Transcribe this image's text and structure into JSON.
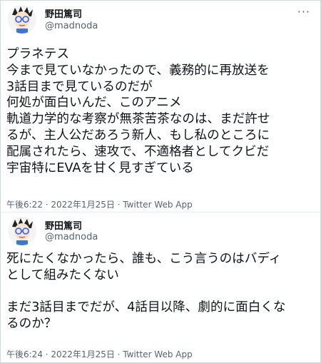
{
  "tweets": [
    {
      "author_name": "野田篤司",
      "author_handle": "@madnoda",
      "more_label": "···",
      "lines": [
        "プラネテス",
        "今まで見ていなかったので、義務的に再放送を",
        "3話目まで見ているのだが",
        "何処が面白いんだ、このアニメ",
        "軌道力学的な考察が無茶苦茶なのは、まだ許せ",
        "るが、主人公だあろう新人、もし私のところに",
        "配属されたら、速攻で、不適格者としてクビだ",
        "宇宙特にEVAを甘く見すぎている"
      ],
      "timestamp": "午後6:22 · 2022年1月25日 · Twitter Web App"
    },
    {
      "author_name": "野田篤司",
      "author_handle": "@madnoda",
      "lines": [
        "死にたくなかったら、誰も、こう言うのはバディ",
        "として組みたくない",
        "",
        "まだ3話目までだが、4話目以降、劇的に面白くな",
        "るのか？"
      ],
      "timestamp": "午後6:24 · 2022年1月25日 · Twitter Web App"
    }
  ],
  "colors": {
    "text": "#0f1419",
    "secondary": "#536471",
    "border": "#cfd9de"
  },
  "icons": [
    "avatar-cartoon-icon",
    "more-options-icon"
  ]
}
